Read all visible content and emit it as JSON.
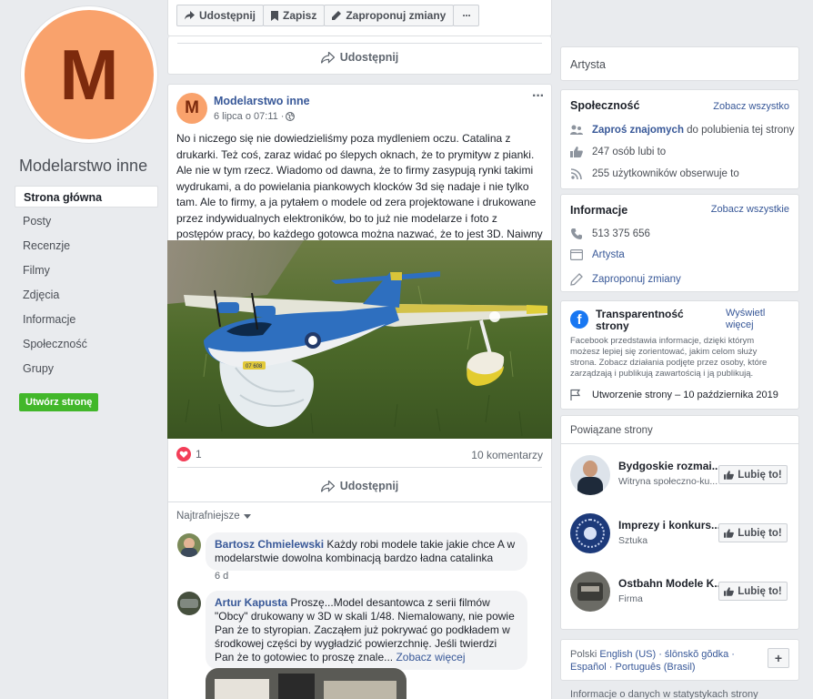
{
  "sidebar": {
    "avatar_letter": "M",
    "page_name": "Modelarstwo inne",
    "items": [
      {
        "label": "Strona główna"
      },
      {
        "label": "Posty"
      },
      {
        "label": "Recenzje"
      },
      {
        "label": "Filmy"
      },
      {
        "label": "Zdjęcia"
      },
      {
        "label": "Informacje"
      },
      {
        "label": "Społeczność"
      },
      {
        "label": "Grupy"
      }
    ],
    "create_page": "Utwórz stronę"
  },
  "toolbar": {
    "share": "Udostępnij",
    "save": "Zapisz",
    "suggest": "Zaproponuj zmiany",
    "more": "···"
  },
  "prev_post": {
    "share": "Udostępnij"
  },
  "post": {
    "author": "Modelarstwo inne",
    "avatar_letter": "M",
    "date": "6 lipca o 07:11 · ",
    "more": "···",
    "text": "No i niczego się nie dowiedzieliśmy poza mydleniem oczu. Catalina z drukarki. Też coś, zaraz widać po ślepych oknach, że to prymityw z pianki. Ale nie w tym rzecz. Wiadomo od dawna, że to firmy zasypują rynki takimi wydrukami, a do powielania piankowych klocków 3d się nadaje i nie tylko tam. Ale to firmy, a ja pytałem o modele od zera projektowane i drukowane przez indywidualnych elektroników, bo to już nie modelarze i foto z postępów pracy, bo każdego gotowca można nazwać, że to jest 3D. Naiwny uwierzy.",
    "plane_reg": "07 608",
    "reactions": "1",
    "comments_count": "10 komentarzy",
    "share": "Udostępnij",
    "sort": "Najtrafniejsze"
  },
  "comments": [
    {
      "author": "Bartosz Chmielewski",
      "text": " Każdy robi modele takie jakie chce A w modelarstwie dowolna kombinacją bardzo ładna catalinka",
      "time": "6 d"
    },
    {
      "author": "Artur Kapusta",
      "text": " Proszę...Model desantowca z serii filmów \"Obcy\" drukowany w 3D w skali 1/48. Niemalowany, nie powie Pan że to styropian. Zacząłem już pokrywać go podkładem w środkowej części by wygładzić powierzchnię. Jeśli twierdzi Pan że to gotowiec to proszę znale...",
      "see_more": " Zobacz więcej"
    }
  ],
  "right": {
    "category": "Artysta",
    "community": {
      "title": "Społeczność",
      "see_all": "Zobacz wszystko",
      "invite_link": "Zaproś znajomych",
      "invite_rest": " do polubienia tej strony",
      "likes": "247 osób lubi to",
      "follows": "255 użytkowników obserwuje to"
    },
    "info": {
      "title": "Informacje",
      "see_all": "Zobacz wszystkie",
      "phone": "513 375 656",
      "category": "Artysta",
      "suggest": "Zaproponuj zmiany"
    },
    "transparency": {
      "title": "Transparentność strony",
      "show": "Wyświetl więcej",
      "desc": "Facebook przedstawia informacje, dzięki którym możesz lepiej się zorientować, jakim celom służy strona. Zobacz działania podjęte przez osoby, które zarządzają i publikują zawartością i ją publikują.",
      "created": "Utworzenie strony – 10 października 2019"
    },
    "related": {
      "title": "Powiązane strony",
      "like": "Lubię to!",
      "pages": [
        {
          "name": "Bydgoskie rozmai...",
          "sub": "Witryna społeczno-ku..."
        },
        {
          "name": "Imprezy i konkurs...",
          "sub": "Sztuka"
        },
        {
          "name": "Ostbahn Modele K...",
          "sub": "Firma"
        }
      ]
    },
    "languages": {
      "current": "Polski",
      "list": "English (US) · ślōnskŏ gŏdka · Español · Português (Brasil)",
      "add": "+"
    },
    "footer_cut": "Informacje o danych w statystykach strony"
  },
  "colors": {
    "fb_blue": "#385898",
    "avatar_orange": "#f9a26c",
    "avatar_letter": "#7c2a0d",
    "create_green": "#42b72a",
    "heart_red": "#f33e58"
  }
}
